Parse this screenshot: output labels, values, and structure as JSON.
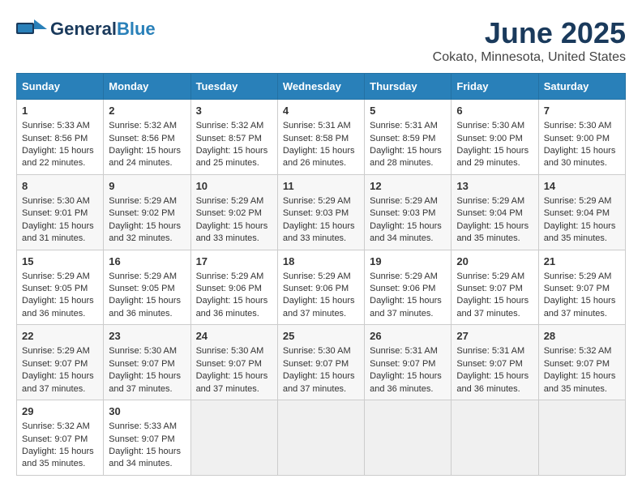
{
  "header": {
    "logo_general": "General",
    "logo_blue": "Blue",
    "month_title": "June 2025",
    "location": "Cokato, Minnesota, United States"
  },
  "weekdays": [
    "Sunday",
    "Monday",
    "Tuesday",
    "Wednesday",
    "Thursday",
    "Friday",
    "Saturday"
  ],
  "weeks": [
    [
      {
        "day": 1,
        "lines": [
          "Sunrise: 5:33 AM",
          "Sunset: 8:56 PM",
          "Daylight: 15 hours",
          "and 22 minutes."
        ]
      },
      {
        "day": 2,
        "lines": [
          "Sunrise: 5:32 AM",
          "Sunset: 8:56 PM",
          "Daylight: 15 hours",
          "and 24 minutes."
        ]
      },
      {
        "day": 3,
        "lines": [
          "Sunrise: 5:32 AM",
          "Sunset: 8:57 PM",
          "Daylight: 15 hours",
          "and 25 minutes."
        ]
      },
      {
        "day": 4,
        "lines": [
          "Sunrise: 5:31 AM",
          "Sunset: 8:58 PM",
          "Daylight: 15 hours",
          "and 26 minutes."
        ]
      },
      {
        "day": 5,
        "lines": [
          "Sunrise: 5:31 AM",
          "Sunset: 8:59 PM",
          "Daylight: 15 hours",
          "and 28 minutes."
        ]
      },
      {
        "day": 6,
        "lines": [
          "Sunrise: 5:30 AM",
          "Sunset: 9:00 PM",
          "Daylight: 15 hours",
          "and 29 minutes."
        ]
      },
      {
        "day": 7,
        "lines": [
          "Sunrise: 5:30 AM",
          "Sunset: 9:00 PM",
          "Daylight: 15 hours",
          "and 30 minutes."
        ]
      }
    ],
    [
      {
        "day": 8,
        "lines": [
          "Sunrise: 5:30 AM",
          "Sunset: 9:01 PM",
          "Daylight: 15 hours",
          "and 31 minutes."
        ]
      },
      {
        "day": 9,
        "lines": [
          "Sunrise: 5:29 AM",
          "Sunset: 9:02 PM",
          "Daylight: 15 hours",
          "and 32 minutes."
        ]
      },
      {
        "day": 10,
        "lines": [
          "Sunrise: 5:29 AM",
          "Sunset: 9:02 PM",
          "Daylight: 15 hours",
          "and 33 minutes."
        ]
      },
      {
        "day": 11,
        "lines": [
          "Sunrise: 5:29 AM",
          "Sunset: 9:03 PM",
          "Daylight: 15 hours",
          "and 33 minutes."
        ]
      },
      {
        "day": 12,
        "lines": [
          "Sunrise: 5:29 AM",
          "Sunset: 9:03 PM",
          "Daylight: 15 hours",
          "and 34 minutes."
        ]
      },
      {
        "day": 13,
        "lines": [
          "Sunrise: 5:29 AM",
          "Sunset: 9:04 PM",
          "Daylight: 15 hours",
          "and 35 minutes."
        ]
      },
      {
        "day": 14,
        "lines": [
          "Sunrise: 5:29 AM",
          "Sunset: 9:04 PM",
          "Daylight: 15 hours",
          "and 35 minutes."
        ]
      }
    ],
    [
      {
        "day": 15,
        "lines": [
          "Sunrise: 5:29 AM",
          "Sunset: 9:05 PM",
          "Daylight: 15 hours",
          "and 36 minutes."
        ]
      },
      {
        "day": 16,
        "lines": [
          "Sunrise: 5:29 AM",
          "Sunset: 9:05 PM",
          "Daylight: 15 hours",
          "and 36 minutes."
        ]
      },
      {
        "day": 17,
        "lines": [
          "Sunrise: 5:29 AM",
          "Sunset: 9:06 PM",
          "Daylight: 15 hours",
          "and 36 minutes."
        ]
      },
      {
        "day": 18,
        "lines": [
          "Sunrise: 5:29 AM",
          "Sunset: 9:06 PM",
          "Daylight: 15 hours",
          "and 37 minutes."
        ]
      },
      {
        "day": 19,
        "lines": [
          "Sunrise: 5:29 AM",
          "Sunset: 9:06 PM",
          "Daylight: 15 hours",
          "and 37 minutes."
        ]
      },
      {
        "day": 20,
        "lines": [
          "Sunrise: 5:29 AM",
          "Sunset: 9:07 PM",
          "Daylight: 15 hours",
          "and 37 minutes."
        ]
      },
      {
        "day": 21,
        "lines": [
          "Sunrise: 5:29 AM",
          "Sunset: 9:07 PM",
          "Daylight: 15 hours",
          "and 37 minutes."
        ]
      }
    ],
    [
      {
        "day": 22,
        "lines": [
          "Sunrise: 5:29 AM",
          "Sunset: 9:07 PM",
          "Daylight: 15 hours",
          "and 37 minutes."
        ]
      },
      {
        "day": 23,
        "lines": [
          "Sunrise: 5:30 AM",
          "Sunset: 9:07 PM",
          "Daylight: 15 hours",
          "and 37 minutes."
        ]
      },
      {
        "day": 24,
        "lines": [
          "Sunrise: 5:30 AM",
          "Sunset: 9:07 PM",
          "Daylight: 15 hours",
          "and 37 minutes."
        ]
      },
      {
        "day": 25,
        "lines": [
          "Sunrise: 5:30 AM",
          "Sunset: 9:07 PM",
          "Daylight: 15 hours",
          "and 37 minutes."
        ]
      },
      {
        "day": 26,
        "lines": [
          "Sunrise: 5:31 AM",
          "Sunset: 9:07 PM",
          "Daylight: 15 hours",
          "and 36 minutes."
        ]
      },
      {
        "day": 27,
        "lines": [
          "Sunrise: 5:31 AM",
          "Sunset: 9:07 PM",
          "Daylight: 15 hours",
          "and 36 minutes."
        ]
      },
      {
        "day": 28,
        "lines": [
          "Sunrise: 5:32 AM",
          "Sunset: 9:07 PM",
          "Daylight: 15 hours",
          "and 35 minutes."
        ]
      }
    ],
    [
      {
        "day": 29,
        "lines": [
          "Sunrise: 5:32 AM",
          "Sunset: 9:07 PM",
          "Daylight: 15 hours",
          "and 35 minutes."
        ]
      },
      {
        "day": 30,
        "lines": [
          "Sunrise: 5:33 AM",
          "Sunset: 9:07 PM",
          "Daylight: 15 hours",
          "and 34 minutes."
        ]
      },
      null,
      null,
      null,
      null,
      null
    ]
  ]
}
